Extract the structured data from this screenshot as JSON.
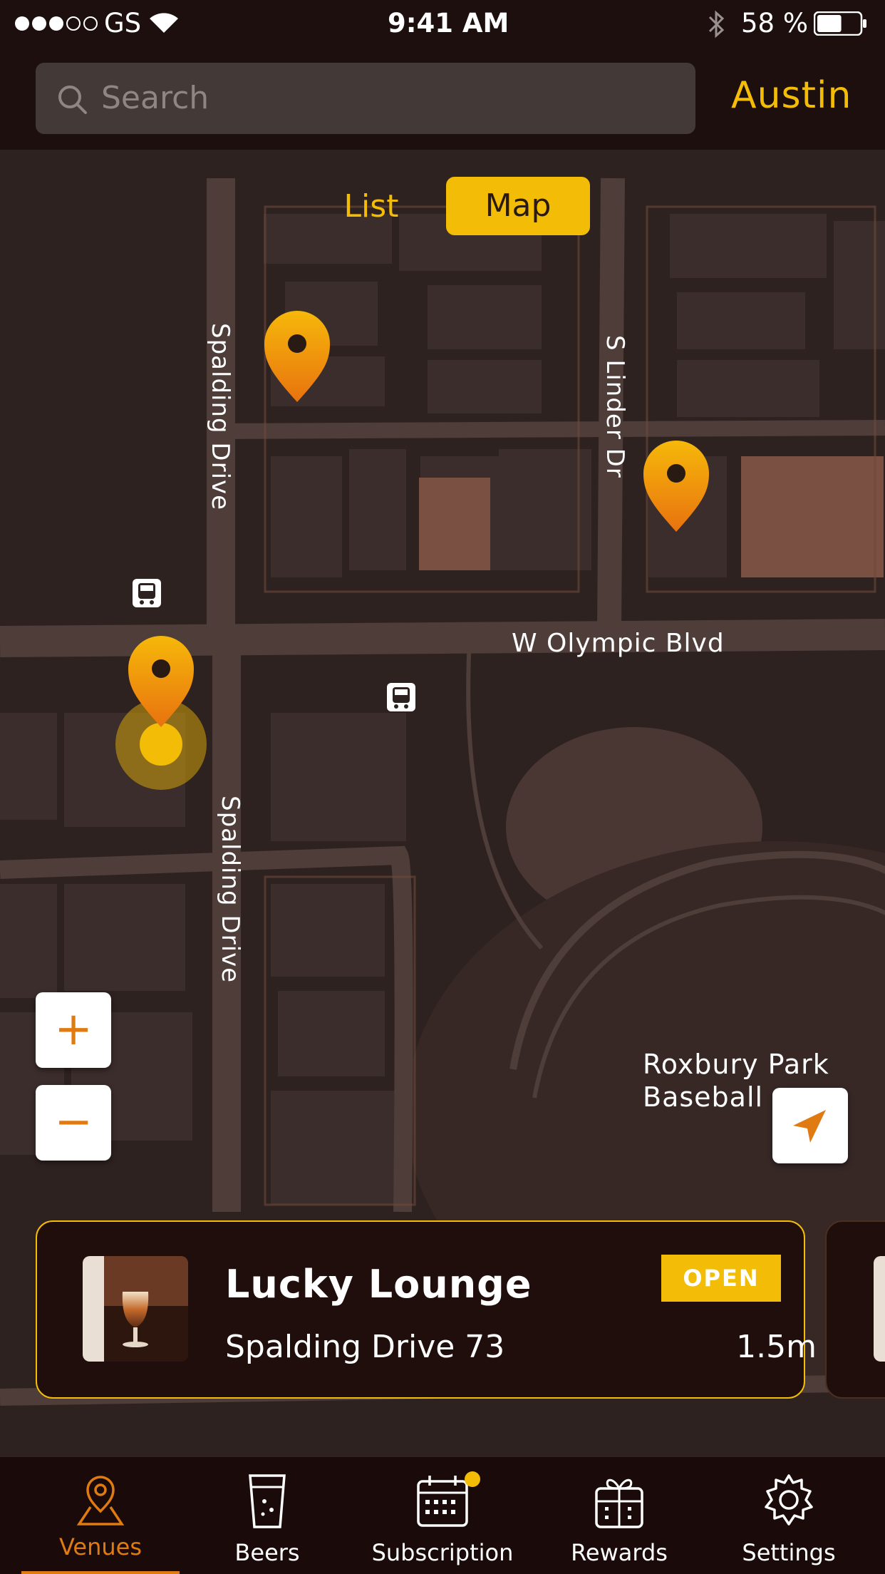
{
  "status_bar": {
    "carrier": "GS",
    "time": "9:41 AM",
    "battery_percent": "58 %",
    "battery_level": 0.58
  },
  "search": {
    "placeholder": "Search"
  },
  "city": "Austin",
  "view_toggle": {
    "list_label": "List",
    "map_label": "Map",
    "active": "Map"
  },
  "map": {
    "street_labels": [
      "Spalding Drive",
      "S Linder Dr",
      "W Olympic Blvd",
      "Spalding Drive"
    ],
    "park_label_line1": "Roxbury Park",
    "park_label_line2": "Baseball"
  },
  "zoom": {
    "in_symbol": "+",
    "out_symbol": "−"
  },
  "venue_card": {
    "name": "Lucky Lounge",
    "address": "Spalding Drive 73",
    "status": "OPEN",
    "distance": "1.5m"
  },
  "tabs": [
    {
      "label": "Venues",
      "icon": "map-pin-icon",
      "active": true
    },
    {
      "label": "Beers",
      "icon": "beer-glass-icon",
      "active": false
    },
    {
      "label": "Subscription",
      "icon": "calendar-icon",
      "active": false,
      "has_badge": true
    },
    {
      "label": "Rewards",
      "icon": "gift-icon",
      "active": false
    },
    {
      "label": "Settings",
      "icon": "gear-icon",
      "active": false
    }
  ],
  "colors": {
    "accent": "#f3bd07",
    "active_tab": "#e07b12",
    "map_background": "#2e2220",
    "road": "#4e3d38",
    "building": "#3b2d2b",
    "highlight_building": "#7a5043"
  }
}
